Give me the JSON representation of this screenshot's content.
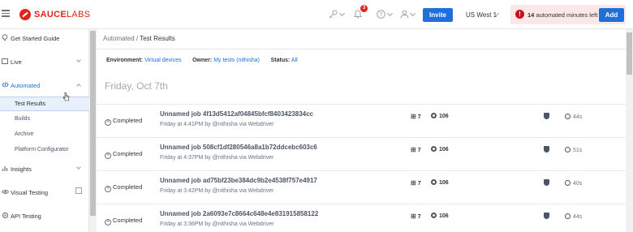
{
  "brand": {
    "name_bold": "SAUCE",
    "name_light": "LABS",
    "color": "#e2231a"
  },
  "topbar": {
    "notification_count": "3",
    "invite_label": "Invite",
    "region": "US West 1",
    "minutes_count": "14",
    "minutes_label": "automated minutes left",
    "add_label": "Add",
    "icons": [
      "hamburger-icon",
      "key-icon",
      "bell-icon",
      "help-icon",
      "user-icon",
      "alert-icon"
    ]
  },
  "sidebar": {
    "items": [
      {
        "label": "Get Started Guide",
        "icon": "lightbulb-icon"
      },
      {
        "label": "Live",
        "icon": "live-icon"
      },
      {
        "label": "Automated",
        "icon": "code-icon"
      },
      {
        "label": "Insights",
        "icon": "insights-icon"
      },
      {
        "label": "Visual Testing",
        "icon": "eye-icon"
      },
      {
        "label": "API Testing",
        "icon": "api-icon"
      }
    ],
    "subitems": [
      {
        "label": "Test Results"
      },
      {
        "label": "Builds"
      },
      {
        "label": "Archive"
      },
      {
        "label": "Platform Configurator"
      }
    ]
  },
  "main": {
    "breadcrumb_parent": "Automated",
    "breadcrumb_sep": " / ",
    "breadcrumb_current": "Test Results",
    "filters": {
      "environment_label": "Environment:",
      "environment_value": "Virtual devices",
      "owner_label": "Owner:",
      "owner_value": "My tests (nithisha)",
      "status_label": "Status:",
      "status_value": "All"
    },
    "date_heading": "Friday, Oct 7th",
    "jobs": [
      {
        "status": "Completed",
        "name": "Unnamed job 4f13d5412af04845bfcf8403423834cc",
        "meta": "Friday at 4:41PM by @nithisha via Webdriver",
        "os_version": "7",
        "browser_version": "106",
        "duration": "44s"
      },
      {
        "status": "Completed",
        "name": "Unnamed job 508cf1df280546a8a1b72ddcebc603c6",
        "meta": "Friday at 4:37PM by @nithisha via Webdriver",
        "os_version": "7",
        "browser_version": "106",
        "duration": "51s"
      },
      {
        "status": "Completed",
        "name": "Unnamed job ad75bf23be384dc9b2e4538f757e4917",
        "meta": "Friday at 3:42PM by @nithisha via Webdriver",
        "os_version": "7",
        "browser_version": "106",
        "duration": "40s"
      },
      {
        "status": "Completed",
        "name": "Unnamed job 2a6093e7c8664c648e4e831915858122",
        "meta": "Friday at 3:36PM by @nithisha via Webdriver",
        "os_version": "7",
        "browser_version": "106",
        "duration": "44s"
      }
    ]
  },
  "colors": {
    "accent": "#1e6fd9",
    "alert_bg": "#fbe7e7",
    "alert": "#c0141b"
  }
}
